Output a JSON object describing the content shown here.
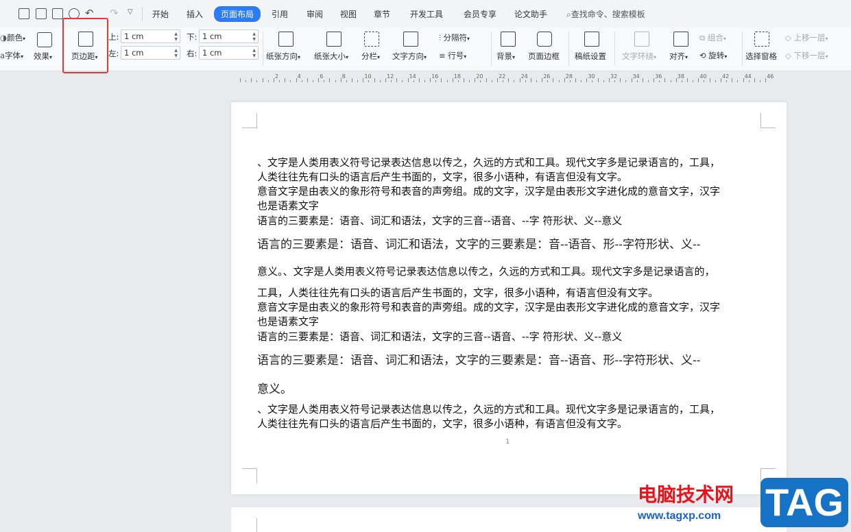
{
  "tabs": [
    "开始",
    "插入",
    "页面布局",
    "引用",
    "审阅",
    "视图",
    "章节",
    "开发工具",
    "会员专享",
    "论文助手"
  ],
  "search": "查找命令、搜索模板",
  "ribbon": {
    "color": "颜色",
    "font": "字体",
    "effect": "效果",
    "margin": "页边距",
    "top_label": "上:",
    "top_value": "1 cm",
    "bottom_label": "下:",
    "bottom_value": "1 cm",
    "left_label": "左:",
    "left_value": "1 cm",
    "right_label": "右:",
    "right_value": "1 cm",
    "orientation": "纸张方向",
    "size": "纸张大小",
    "columns": "分栏",
    "text_direction": "文字方向",
    "separator": "分隔符",
    "line_number": "行号",
    "background": "背景",
    "page_border": "页面边框",
    "manuscript": "稿纸设置",
    "text_wrap": "文字环绕",
    "align": "对齐",
    "group": "组合",
    "rotate": "旋转",
    "select_pane": "选择窗格",
    "bring_forward": "上移一层",
    "send_backward": "下移一层"
  },
  "ruler_numbers": [
    "2",
    "4",
    "6",
    "8",
    "10",
    "12",
    "14",
    "16",
    "18",
    "20",
    "22",
    "24",
    "26",
    "28",
    "30",
    "32",
    "34",
    "36",
    "38",
    "40",
    "42",
    "44",
    "46"
  ],
  "document": {
    "lines": [
      "、文字是人类用表义符号记录表达信息以传之，久远的方式和工具。现代文字多是记录语言的，工具，",
      "人类往往先有口头的语言后产生书面的，文字，很多小语种，有语言但没有文字。",
      "意音文字是由表义的象形符号和表音的声旁组。成的文字，汉字是由表形文字进化成的意音文字，汉字",
      "也是语素文字",
      "语言的三要素是：语音、词汇和语法，文字的三音--语音、--字  符形状、义--意义",
      "语言的三要素是：语音、词汇和语法，文字的三要素是：音--语音、形--字符形状、义--",
      "意义。、文字是人类用表义符号记录表达信息以传之，久远的方式和工具。现代文字多是记录语言的，",
      "工具，人类往往先有口头的语言后产生书面的，文字，很多小语种，有语言但没有文字。",
      "意音文字是由表义的象形符号和表音的声旁组。成的文字，汉字是由表形文字进化成的意音文字，汉字",
      "也是语素文字",
      "语言的三要素是：语音、词汇和语法，文字的三音--语音、--字  符形状、义--意义",
      "语言的三要素是：语音、词汇和语法，文字的三要素是：音--语音、形--字符形状、义--",
      "意义。",
      "、文字是人类用表义符号记录表达信息以传之，久远的方式和工具。现代文字多是记录语言的，工具，",
      "人类往往先有口头的语言后产生书面的，文字，很多小语种，有语言但没有文字。"
    ],
    "page_number": "1"
  },
  "watermark": {
    "text": "电脑技术网",
    "url": "www.tagxp.com",
    "logo": "TAG"
  }
}
